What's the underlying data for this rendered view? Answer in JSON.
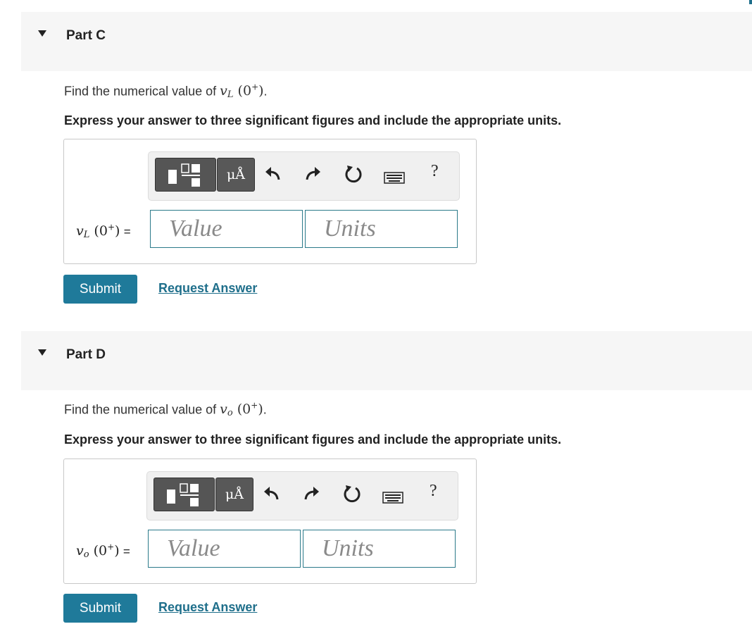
{
  "parts": [
    {
      "title": "Part C",
      "question_prefix": "Find the numerical value of ",
      "var": "v",
      "sub": "L",
      "arg_open": "(0",
      "arg_sup": "+",
      "arg_close": ")",
      "question_suffix": ".",
      "instruction": "Express your answer to three significant figures and include the appropriate units.",
      "eq_sign": "=",
      "value_placeholder": "Value",
      "units_placeholder": "Units",
      "units_button": "μÅ",
      "help": "?",
      "submit": "Submit",
      "request_answer": "Request Answer"
    },
    {
      "title": "Part D",
      "question_prefix": "Find the numerical value of ",
      "var": "v",
      "sub": "o",
      "arg_open": "(0",
      "arg_sup": "+",
      "arg_close": ")",
      "question_suffix": ".",
      "instruction": "Express your answer to three significant figures and include the appropriate units.",
      "eq_sign": "=",
      "value_placeholder": "Value",
      "units_placeholder": "Units",
      "units_button": "μÅ",
      "help": "?",
      "submit": "Submit",
      "request_answer": "Request Answer"
    }
  ],
  "icons": [
    "templates-icon",
    "units-icon",
    "undo-icon",
    "redo-icon",
    "reset-icon",
    "keyboard-icon",
    "help-icon",
    "collapse-toggle-icon"
  ],
  "colors": {
    "submit": "#1f7a9a",
    "link": "#1f6f8b",
    "field_border": "#2b7a8a",
    "header_bg": "#f6f6f6"
  }
}
